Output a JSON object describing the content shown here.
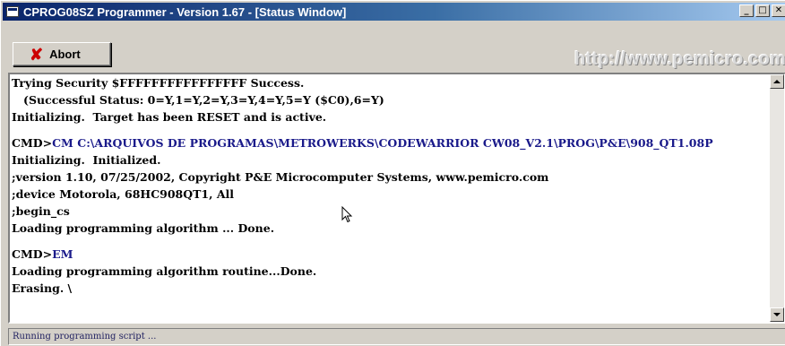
{
  "window": {
    "title": "CPROG08SZ Programmer - Version 1.67 - [Status Window]",
    "buttons": {
      "minimize": "_",
      "maximize": "□",
      "close": "✕"
    }
  },
  "toolbar": {
    "abort_label": "Abort",
    "abort_icon": "✘",
    "url": "http://www.pemicro.com"
  },
  "console": {
    "lines": {
      "l1": "Trying Security $FFFFFFFFFFFFFFFF Success.",
      "l2": "   (Successful Status: 0=Y,1=Y,2=Y,3=Y,4=Y,5=Y ($C0),6=Y)",
      "l3": "Initializing.  Target has been RESET and is active.",
      "l4_prompt": "CMD>",
      "l4_cmd": "CM C:\\ARQUIVOS DE PROGRAMAS\\METROWERKS\\CODEWARRIOR CW08_V2.1\\PROG\\P&E\\908_QT1.08P",
      "l5": "Initializing.  Initialized.",
      "l6": ";version 1.10, 07/25/2002, Copyright P&E Microcomputer Systems, www.pemicro.com",
      "l7": ";device Motorola, 68HC908QT1, All",
      "l8": ";begin_cs",
      "l9": "Loading programming algorithm ... Done.",
      "l10_prompt": "CMD>",
      "l10_cmd": "EM",
      "l11": "Loading programming algorithm routine...Done.",
      "l12": "Erasing. \\"
    }
  },
  "statusbar": {
    "text": "Running programming script ..."
  }
}
